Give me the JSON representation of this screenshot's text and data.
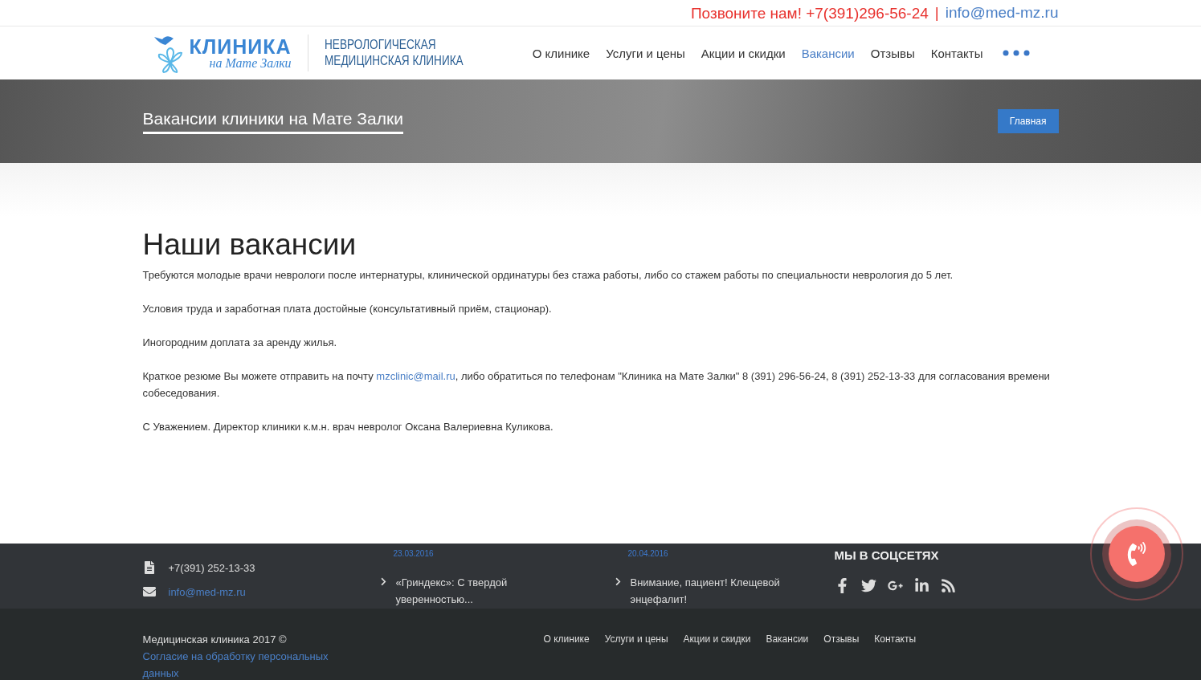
{
  "topbar": {
    "call": "Позвоните нам! +7(391)296-56-24",
    "separator": "|",
    "email": "info@med-mz.ru"
  },
  "logo": {
    "title": "КЛИНИКА",
    "subtitle": "на Мате Залки",
    "tagline": [
      "НЕВРОЛОГИЧЕСКАЯ",
      "МЕДИЦИНСКАЯ КЛИНИКА"
    ]
  },
  "nav": [
    {
      "label": "О клинике",
      "selected": false
    },
    {
      "label": "Услуги и цены",
      "selected": false
    },
    {
      "label": "Акции и скидки",
      "selected": false
    },
    {
      "label": "Вакансии",
      "selected": true
    },
    {
      "label": "Отзывы",
      "selected": false
    },
    {
      "label": "Контакты",
      "selected": false
    }
  ],
  "banner": {
    "title": "Вакансии клиники на Мате Залки",
    "breadcrumb": "Главная"
  },
  "content": {
    "heading": "Наши вакансии",
    "paragraphs": [
      {
        "text": "Требуются молодые врачи неврологи после интернатуры, клинической ординатуры без стажа работы, либо со стажем работы по специальности неврология до 5 лет."
      },
      {
        "text": "Условия труда и заработная плата достойные (консультативный приём, стационар)."
      },
      {
        "text": "Иногородним доплата за аренду жилья."
      },
      {
        "text": "Краткое резюме Вы можете отправить на почту ",
        "link": "mzclinic@mail.ru",
        "after": ", либо обратиться по телефонам \"Клиника на Мате Залки\" 8 (391) 296-56-24, 8 (391) 252-13-33 для согласования времени собеседования."
      },
      {
        "text": "С Уважением. Директор клиники к.м.н. врач невролог Оксана Валериевна Куликова."
      }
    ]
  },
  "footer": {
    "contacts": [
      {
        "kind": "fax",
        "text": "+7(391) 252-13-33"
      },
      {
        "kind": "mail",
        "text": "info@med-mz.ru"
      }
    ],
    "news": [
      {
        "date": "23.03.2016",
        "title": "«Гриндекс»: С твердой уверенностью..."
      },
      {
        "date": "20.04.2016",
        "title": "Внимание, пациент! Клещевой энцефалит!"
      }
    ],
    "social": {
      "title": "МЫ В СОЦСЕТЯХ"
    },
    "copyright": "Медицинская клиника 2017 ©",
    "consent": "Согласие на обработку персональных данных",
    "links": [
      "О клинике",
      "Услуги и цены",
      "Акции и скидки",
      "Вакансии",
      "Отзывы",
      "Контакты"
    ]
  }
}
